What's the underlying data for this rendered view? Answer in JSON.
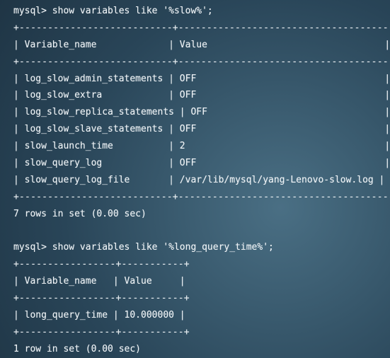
{
  "terminal": {
    "lines": [
      "mysql> show variables like '%slow%';",
      "+---------------------------+--------------------------------------+",
      "| Variable_name             | Value                                |",
      "+---------------------------+--------------------------------------+",
      "| log_slow_admin_statements | OFF                                  |",
      "| log_slow_extra            | OFF                                  |",
      "| log_slow_replica_statements | OFF                                |",
      "| log_slow_slave_statements | OFF                                  |",
      "| slow_launch_time          | 2                                    |",
      "| slow_query_log            | OFF                                  |",
      "| slow_query_log_file       | /var/lib/mysql/yang-Lenovo-slow.log |",
      "+---------------------------+--------------------------------------+",
      "7 rows in set (0.00 sec)",
      "",
      "mysql> show variables like '%long_query_time%';",
      "+-----------------+-----------+",
      "| Variable_name   | Value     |",
      "+-----------------+-----------+",
      "| long_query_time | 10.000000 |",
      "+-----------------+-----------+",
      "1 row in set (0.00 sec)"
    ]
  }
}
